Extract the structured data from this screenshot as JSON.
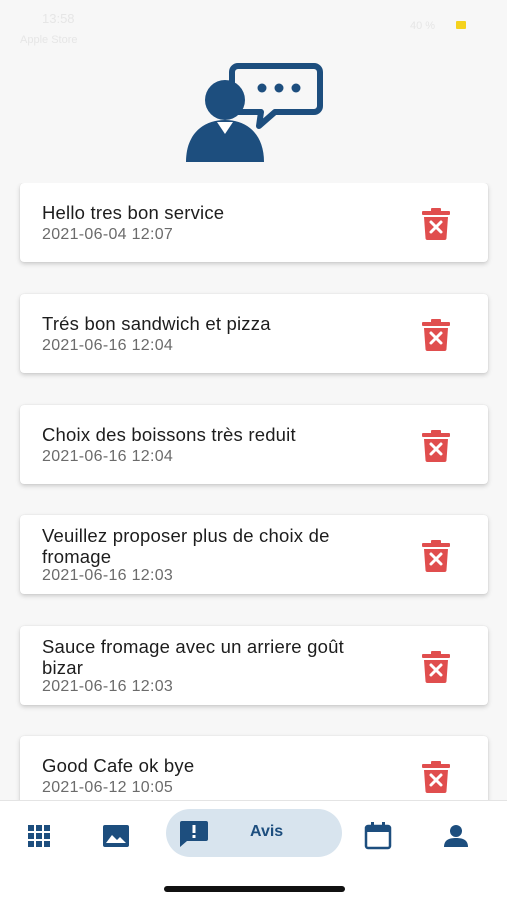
{
  "status_bar": {
    "time": "13:58",
    "carrier": "Apple Store",
    "battery": "40 %"
  },
  "reviews": [
    {
      "text": "Hello tres bon service",
      "date": "2021-06-04 12:07"
    },
    {
      "text": "Trés bon sandwich et pizza",
      "date": "2021-06-16 12:04"
    },
    {
      "text": "Choix des boissons très reduit",
      "date": "2021-06-16 12:04"
    },
    {
      "text": "Veuillez proposer plus de choix de fromage",
      "date": "2021-06-16 12:03"
    },
    {
      "text": "Sauce fromage avec un arriere goût bizar",
      "date": "2021-06-16 12:03"
    },
    {
      "text": "Good Cafe ok bye",
      "date": "2021-06-12 10:05"
    }
  ],
  "bottom_nav": {
    "items": [
      {
        "icon": "grid-icon",
        "label": ""
      },
      {
        "icon": "image-icon",
        "label": ""
      },
      {
        "icon": "feedback-icon",
        "label": "Avis",
        "active": true
      },
      {
        "icon": "calendar-icon",
        "label": ""
      },
      {
        "icon": "person-icon",
        "label": ""
      }
    ]
  },
  "colors": {
    "primary": "#1d4e7e",
    "delete": "#e04e4e",
    "active_pill": "#d8e4ee",
    "background": "#f7f7f7"
  }
}
